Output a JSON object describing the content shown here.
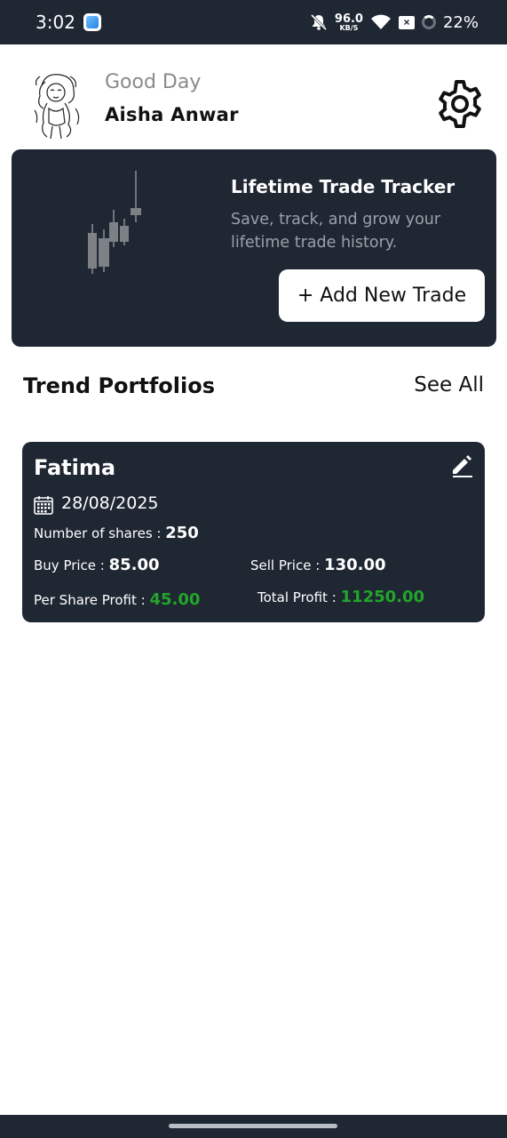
{
  "status_bar": {
    "time": "3:02",
    "speed_value": "96.0",
    "speed_unit": "KB/S",
    "battery": "22%"
  },
  "header": {
    "greeting": "Good Day",
    "user_name": "Aisha Anwar"
  },
  "banner": {
    "title": "Lifetime Trade Tracker",
    "subtitle": "Save, track, and grow your lifetime trade history.",
    "add_button_label": "+ Add New Trade"
  },
  "section": {
    "title": "Trend Portfolios",
    "see_all_label": "See All"
  },
  "trades": [
    {
      "name": "Fatima",
      "date": "28/08/2025",
      "shares_label": "Number of shares : ",
      "shares": "250",
      "buy_label": "Buy Price : ",
      "buy_price": "85.00",
      "sell_label": "Sell Price : ",
      "sell_price": "130.00",
      "per_share_label": "Per Share Profit : ",
      "per_share_profit": "45.00",
      "total_label": "Total Profit : ",
      "total_profit": "11250.00"
    }
  ],
  "colors": {
    "dark": "#1f2733",
    "profit_green": "#22a52a",
    "muted_text": "#9aa1ab"
  },
  "icons": [
    "bell-off-icon",
    "wifi-icon",
    "battery-ring-icon",
    "settings-gear-icon",
    "candlestick-chart-icon",
    "edit-pencil-icon",
    "calendar-icon"
  ]
}
